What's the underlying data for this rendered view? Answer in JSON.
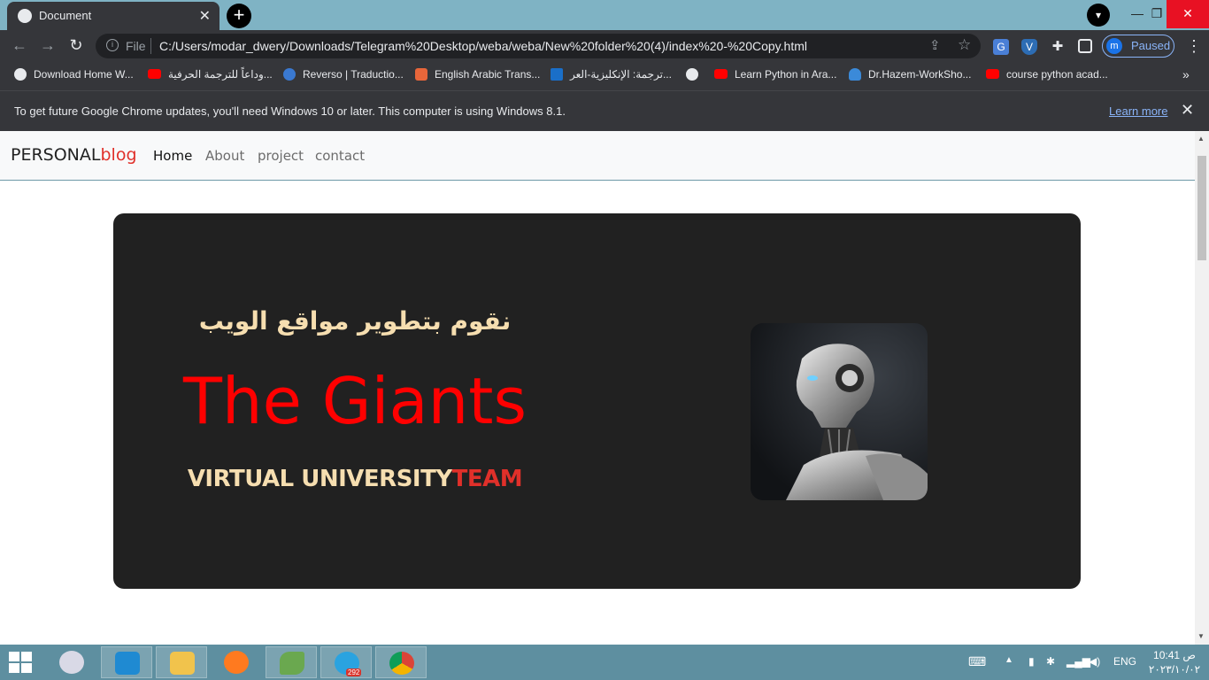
{
  "browser": {
    "tab_title": "Document",
    "tab_close": "✕",
    "new_tab": "+",
    "file_label": "File",
    "url": "C:/Users/modar_dwery/Downloads/Telegram%20Desktop/weba/weba/New%20folder%20(4)/index%20-%20Copy.html",
    "profile_initial": "m",
    "profile_status": "Paused"
  },
  "bookmarks": [
    {
      "label": "Download Home W...",
      "icon": "globe-icon"
    },
    {
      "label": "وداعاً للترجمة الحرفية...",
      "icon": "youtube-icon"
    },
    {
      "label": "Reverso | Traductio...",
      "icon": "reverso-icon"
    },
    {
      "label": "English Arabic Trans...",
      "icon": "translate-icon"
    },
    {
      "label": "ترجمة: الإنكليزية-العر...",
      "icon": "tumblr-icon"
    },
    {
      "label": "",
      "icon": "globe-icon"
    },
    {
      "label": "Learn Python in Ara...",
      "icon": "youtube-icon"
    },
    {
      "label": "Dr.Hazem-WorkSho...",
      "icon": "onedrive-icon"
    },
    {
      "label": "course python acad...",
      "icon": "youtube-icon"
    }
  ],
  "infobar": {
    "message": "To get future Google Chrome updates, you'll need Windows 10 or later. This computer is using Windows 8.1.",
    "learn_more": "Learn more"
  },
  "site": {
    "brand_main": "PERSONAL",
    "brand_accent": "blog",
    "nav": [
      "Home",
      "About",
      "project",
      "contact"
    ],
    "hero": {
      "arabic_tagline": "نقوم بتطوير مواقع الويب",
      "headline": "The Giants",
      "team_main": "VIRTUAL UNIVERSITY",
      "team_accent": "TEAM"
    }
  },
  "taskbar": {
    "telegram_badge": "292",
    "language": "ENG",
    "time": "10:41 ص",
    "date": "٢٠٢٣/١٠/٠٢"
  },
  "colors": {
    "hero_bg": "#212121",
    "headline": "#ff0000",
    "accent": "#e0302a",
    "tagline": "#f6deb0"
  }
}
